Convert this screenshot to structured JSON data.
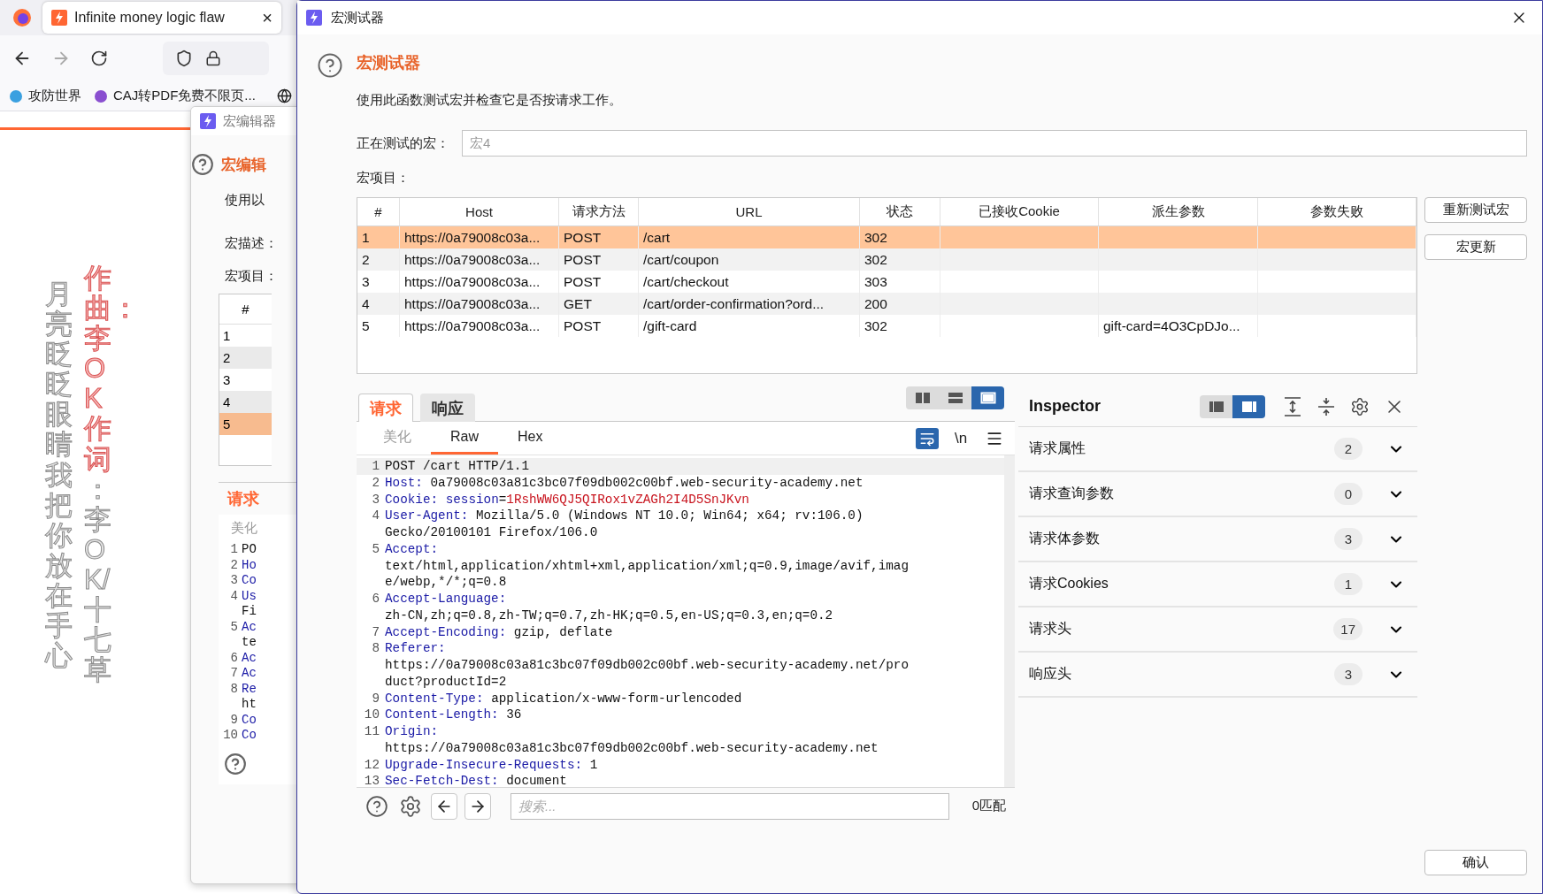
{
  "browser": {
    "tab_title": "Infinite money logic flaw",
    "tab_close": "×",
    "bookmarks": [
      {
        "label": "攻防世界"
      },
      {
        "label": "CAJ转PDF免费不限页..."
      }
    ]
  },
  "lyrics": {
    "line_1": "月亮眨眨眼睛我把你放在手心",
    "line_2_sung": "作曲：李OK作词",
    "line_2_rest": "：李OK/十七草"
  },
  "background_dialog": {
    "title": "宏编辑器",
    "heading": "宏编辑",
    "intro": "使用以",
    "description_label": "宏描述：",
    "items_label": "宏项目：",
    "table_header": "#",
    "rows": [
      {
        "number": "1",
        "selected": false
      },
      {
        "number": "2",
        "selected": false
      },
      {
        "number": "3",
        "selected": false
      },
      {
        "number": "4",
        "selected": false
      },
      {
        "number": "5",
        "selected": true
      }
    ],
    "tab": "请求",
    "subtab": "美化",
    "code_lines": [
      {
        "number": "1",
        "text": "PO",
        "kind": "plain"
      },
      {
        "number": "2",
        "text": "Ho",
        "kind": "header"
      },
      {
        "number": "3",
        "text": "Co",
        "kind": "header"
      },
      {
        "number": "4",
        "text": "Us",
        "kind": "header"
      },
      {
        "text": "Fi",
        "kind": "plain"
      },
      {
        "number": "5",
        "text": "Ac",
        "kind": "header"
      },
      {
        "text": "te",
        "kind": "plain"
      },
      {
        "number": "6",
        "text": "Ac",
        "kind": "header"
      },
      {
        "number": "7",
        "text": "Ac",
        "kind": "header"
      },
      {
        "number": "8",
        "text": "Re",
        "kind": "header"
      },
      {
        "text": "ht",
        "kind": "plain"
      },
      {
        "number": "9",
        "text": "Co",
        "kind": "header"
      },
      {
        "number": "10",
        "text": "Co",
        "kind": "header"
      }
    ]
  },
  "dialog": {
    "title": "宏测试器",
    "heading": "宏测试器",
    "description": "使用此函数测试宏并检查它是否按请求工作。",
    "macro_field": {
      "label": "正在测试的宏：",
      "value": "宏4"
    },
    "items_label": "宏项目：",
    "table": {
      "columns": [
        "#",
        "Host",
        "请求方法",
        "URL",
        "状态",
        "已接收Cookie",
        "派生参数",
        "参数失败"
      ],
      "rows": [
        {
          "number": "1",
          "host": "https://0a79008c03a...",
          "method": "POST",
          "url": "/cart",
          "status": "302",
          "selected": true
        },
        {
          "number": "2",
          "host": "https://0a79008c03a...",
          "method": "POST",
          "url": "/cart/coupon",
          "status": "302",
          "selected": false
        },
        {
          "number": "3",
          "host": "https://0a79008c03a...",
          "method": "POST",
          "url": "/cart/checkout",
          "status": "303",
          "selected": false
        },
        {
          "number": "4",
          "host": "https://0a79008c03a...",
          "method": "GET",
          "url": "/cart/order-confirmation?ord...",
          "status": "200",
          "selected": false
        },
        {
          "number": "5",
          "host": "https://0a79008c03a...",
          "method": "POST",
          "url": "/gift-card",
          "status": "302",
          "derived_params": "gift-card=4O3CpDJo...",
          "selected": false
        }
      ]
    },
    "side_buttons": [
      "重新测试宏",
      "宏更新"
    ],
    "editor": {
      "tabs": [
        {
          "label": "请求",
          "selected": true
        },
        {
          "label": "响应",
          "selected": false
        }
      ],
      "view_modes": [
        {
          "kind": "columns",
          "selected": false
        },
        {
          "kind": "rows",
          "selected": false
        },
        {
          "kind": "single",
          "selected": true
        }
      ],
      "subtabs": [
        {
          "label": "美化",
          "selected": false,
          "disabled": true
        },
        {
          "label": "Raw",
          "selected": true,
          "disabled": false
        },
        {
          "label": "Hex",
          "selected": false,
          "disabled": false
        }
      ],
      "word_wrap_on": true,
      "newline_label": "\\n",
      "lines": [
        {
          "number": "1",
          "rows": [
            [
              {
                "kind": "plain",
                "text": "POST /cart HTTP/1.1"
              }
            ]
          ]
        },
        {
          "number": "2",
          "rows": [
            [
              {
                "kind": "header",
                "text": "Host:"
              },
              {
                "kind": "plain",
                "text": " 0a79008c03a81c3bc07f09db002c00bf.web-security-academy.net"
              }
            ]
          ]
        },
        {
          "number": "3",
          "rows": [
            [
              {
                "kind": "header",
                "text": "Cookie:"
              },
              {
                "kind": "plain",
                "text": " "
              },
              {
                "kind": "cookie_name",
                "text": "session"
              },
              {
                "kind": "plain",
                "text": "="
              },
              {
                "kind": "cookie_value",
                "text": "1RshWW6QJ5QIRox1vZAGh2I4D5SnJKvn"
              }
            ]
          ]
        },
        {
          "number": "4",
          "rows": [
            [
              {
                "kind": "header",
                "text": "User-Agent:"
              },
              {
                "kind": "plain",
                "text": " Mozilla/5.0 (Windows NT 10.0; Win64; x64; rv:106.0)"
              }
            ],
            [
              {
                "kind": "plain",
                "text": "Gecko/20100101 Firefox/106.0"
              }
            ]
          ]
        },
        {
          "number": "5",
          "rows": [
            [
              {
                "kind": "header",
                "text": "Accept:"
              }
            ],
            [
              {
                "kind": "plain",
                "text": "text/html,application/xhtml+xml,application/xml;q=0.9,image/avif,imag"
              }
            ],
            [
              {
                "kind": "plain",
                "text": "e/webp,*/*;q=0.8"
              }
            ]
          ]
        },
        {
          "number": "6",
          "rows": [
            [
              {
                "kind": "header",
                "text": "Accept-Language:"
              }
            ],
            [
              {
                "kind": "plain",
                "text": "zh-CN,zh;q=0.8,zh-TW;q=0.7,zh-HK;q=0.5,en-US;q=0.3,en;q=0.2"
              }
            ]
          ]
        },
        {
          "number": "7",
          "rows": [
            [
              {
                "kind": "header",
                "text": "Accept-Encoding:"
              },
              {
                "kind": "plain",
                "text": " gzip, deflate"
              }
            ]
          ]
        },
        {
          "number": "8",
          "rows": [
            [
              {
                "kind": "header",
                "text": "Referer:"
              }
            ],
            [
              {
                "kind": "plain",
                "text": "https://0a79008c03a81c3bc07f09db002c00bf.web-security-academy.net/pro"
              }
            ],
            [
              {
                "kind": "plain",
                "text": "duct?productId=2"
              }
            ]
          ]
        },
        {
          "number": "9",
          "rows": [
            [
              {
                "kind": "header",
                "text": "Content-Type:"
              },
              {
                "kind": "plain",
                "text": " application/x-www-form-urlencoded"
              }
            ]
          ]
        },
        {
          "number": "10",
          "rows": [
            [
              {
                "kind": "header",
                "text": "Content-Length:"
              },
              {
                "kind": "plain",
                "text": " 36"
              }
            ]
          ]
        },
        {
          "number": "11",
          "rows": [
            [
              {
                "kind": "header",
                "text": "Origin:"
              }
            ],
            [
              {
                "kind": "plain",
                "text": "https://0a79008c03a81c3bc07f09db002c00bf.web-security-academy.net"
              }
            ]
          ]
        },
        {
          "number": "12",
          "rows": [
            [
              {
                "kind": "header",
                "text": "Upgrade-Insecure-Requests:"
              },
              {
                "kind": "plain",
                "text": " 1"
              }
            ]
          ]
        },
        {
          "number": "13",
          "rows": [
            [
              {
                "kind": "header",
                "text": "Sec-Fetch-Dest:"
              },
              {
                "kind": "plain",
                "text": " document"
              }
            ]
          ]
        }
      ],
      "search": {
        "placeholder": "搜索...",
        "match_count": "0匹配"
      }
    },
    "inspector": {
      "title": "Inspector",
      "layout_modes": [
        {
          "kind": "left",
          "selected": false
        },
        {
          "kind": "right",
          "selected": true
        }
      ],
      "sections": [
        {
          "label": "请求属性",
          "count": "2",
          "expanded": false
        },
        {
          "label": "请求查询参数",
          "count": "0",
          "expanded": false
        },
        {
          "label": "请求体参数",
          "count": "3",
          "expanded": false
        },
        {
          "label": "请求Cookies",
          "count": "1",
          "expanded": false
        },
        {
          "label": "请求头",
          "count": "17",
          "expanded": false
        },
        {
          "label": "响应头",
          "count": "3",
          "expanded": false
        }
      ]
    },
    "confirm_button": "确认"
  }
}
